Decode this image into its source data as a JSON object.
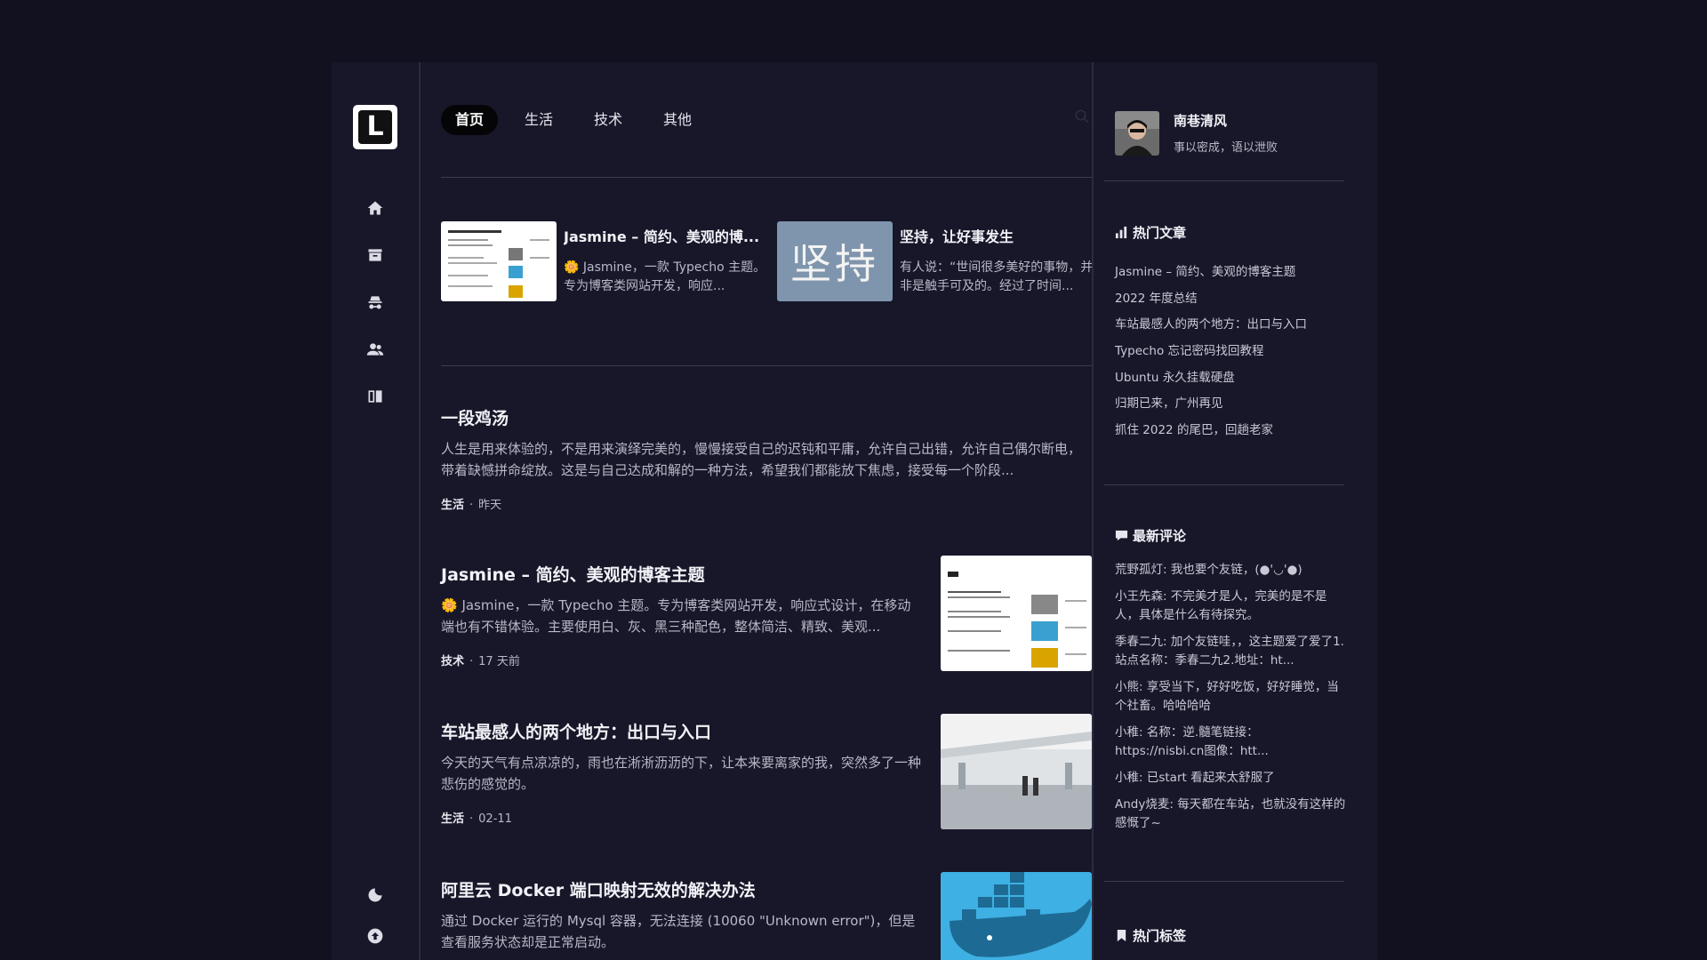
{
  "nav": {
    "logo_letter": "L",
    "tabs": [
      {
        "label": "首页",
        "active": true
      },
      {
        "label": "生活",
        "active": false
      },
      {
        "label": "技术",
        "active": false
      },
      {
        "label": "其他",
        "active": false
      }
    ],
    "rail_icons": [
      "home-icon",
      "archive-icon",
      "spy-icon",
      "friends-icon",
      "book-icon"
    ],
    "bottom_icons": [
      "moon-icon",
      "back-to-top-icon"
    ]
  },
  "featured": [
    {
      "title": "Jasmine – 简约、美观的博...",
      "desc": "🌼 Jasmine，一款 Typecho 主题。专为博客类网站开发，响应..."
    },
    {
      "title": "坚持，让好事发生",
      "desc": "有人说：“世间很多美好的事物，并非是触手可及的。经过了时间...",
      "thumb_text": "坚持"
    }
  ],
  "posts": [
    {
      "title": "一段鸡汤",
      "desc": "人生是用来体验的，不是用来演绎完美的，慢慢接受自己的迟钝和平庸，允许自己出错，允许自己偶尔断电，带着缺憾拼命绽放。这是与自己达成和解的一种方法，希望我们都能放下焦虑，接受每一个阶段...",
      "category": "生活",
      "date": "昨天"
    },
    {
      "title": "Jasmine – 简约、美观的博客主题",
      "desc": "🌼 Jasmine，一款 Typecho 主题。专为博客类网站开发，响应式设计，在移动端也有不错体验。主要使用白、灰、黑三种配色，整体简洁、精致、美观...",
      "category": "技术",
      "date": "17 天前"
    },
    {
      "title": "车站最感人的两个地方：出口与入口",
      "desc": "今天的天气有点凉凉的，雨也在淅淅沥沥的下，让本来要离家的我，突然多了一种悲伤的感觉的。",
      "category": "生活",
      "date": "02-11"
    },
    {
      "title": "阿里云 Docker 端口映射无效的解决办法",
      "desc": "通过 Docker 运行的 Mysql 容器，无法连接 (10060 \"Unknown error\")，但是查看服务状态却是正常启动。",
      "category": "",
      "date": ""
    }
  ],
  "profile": {
    "name": "南巷清风",
    "bio": "事以密成，语以泄败"
  },
  "hot_articles": {
    "title": "热门文章",
    "items": [
      "Jasmine – 简约、美观的博客主题",
      "2022 年度总结",
      "车站最感人的两个地方：出口与入口",
      "Typecho 忘记密码找回教程",
      "Ubuntu 永久挂载硬盘",
      "归期已来，广州再见",
      "抓住 2022 的尾巴，回趟老家"
    ]
  },
  "latest_comments": {
    "title": "最新评论",
    "items": [
      "荒野孤灯: 我也要个友链，(●'◡'●)",
      "小王先森: 不完美才是人，完美的是不是人，具体是什么有待探究。",
      "季春二九: 加个友链哇，，这主题爱了爱了1.站点名称：季春二九2.地址：ht...",
      "小熊: 享受当下，好好吃饭，好好睡觉，当个社畜。哈哈哈哈",
      "小稚: 名称：逆.髓笔链接：https://nisbi.cn图像：htt...",
      "小稚: 已start 看起来太舒服了",
      "Andy烧麦: 每天都在车站，也就没有这样的感慨了~"
    ]
  },
  "hot_tags": {
    "title": "热门标签"
  }
}
